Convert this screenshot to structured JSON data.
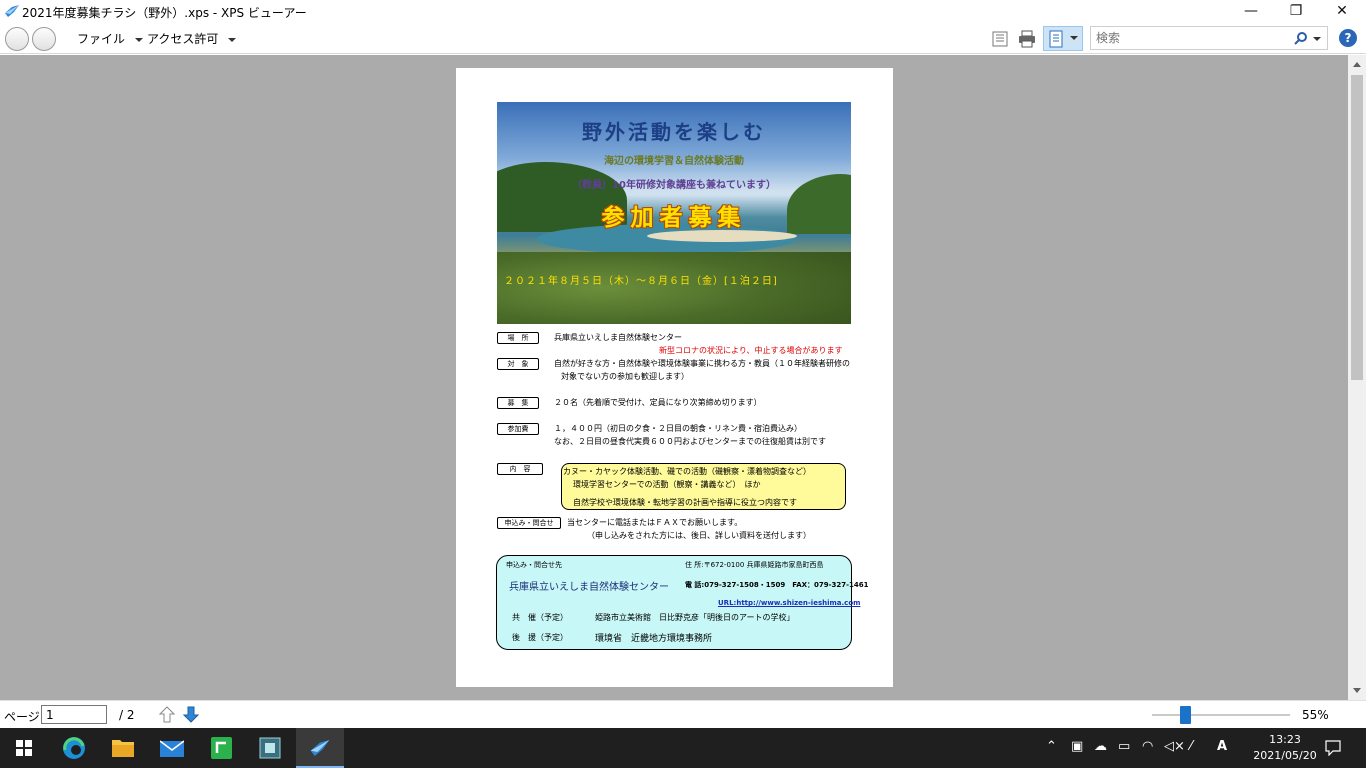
{
  "window": {
    "title": "2021年度募集チラシ（野外）.xps - XPS ビューアー",
    "minimize": "—",
    "maximize": "❐",
    "close": "✕"
  },
  "menu": {
    "file": "ファイル",
    "access": "アクセス許可"
  },
  "search": {
    "placeholder": "検索"
  },
  "help": "?",
  "flyer": {
    "title": "野外活動を楽しむ",
    "subtitle": "海辺の環境学習＆自然体験活動",
    "note": "（教員）10年研修対象講座も兼ねています）",
    "headline": "参加者募集",
    "date": "２０２１年８月５日（木）～８月６日（金）[１泊２日]",
    "rows": {
      "place_label": "場　所",
      "place_text": "兵庫県立いえしま自然体験センター",
      "corona_notice": "新型コロナの状況により、中止する場合があります",
      "target_label": "対　象",
      "target_text1": "自然が好きな方・自然体験や環境体験事業に携わる方・教員（１０年経験者研修の",
      "target_text2": "対象でない方の参加も歓迎します）",
      "recruit_label": "募　集",
      "recruit_text": "２０名（先着順で受付け、定員になり次第締め切ります）",
      "fee_label": "参加費",
      "fee_text1": "１，４００円（初日の夕食・２日目の朝食・リネン費・宿泊費込み）",
      "fee_text2": "なお、２日目の昼食代実費６００円およびセンターまでの往復船賃は別です",
      "content_label": "内　容",
      "content_line1": "カヌー・カヤック体験活動、磯での活動（磯観察・漂着物調査など）",
      "content_line2": "環境学習センターでの活動（観察・講義など）　ほか",
      "content_line3": "自然学校や環境体験・転地学習の計画や指導に役立つ内容です",
      "apply_label": "申込み・問合せ",
      "apply_text1": "当センターに電話またはＦＡＸでお願いします。",
      "apply_text2": "（申し込みをされた方には、後日、詳しい資料を送付します）"
    },
    "contact": {
      "header": "申込み・問合せ先",
      "address": "住 所:〒672-0100 兵庫県姫路市家島町西島",
      "org": "兵庫県立いえしま自然体験センター",
      "phone": "電 話:079-327-1508・1509　FAX：079-327-1461",
      "url": "URL:http://www.shizen-ieshima.com",
      "cohost_label": "共　催（予定）",
      "cohost_text": "姫路市立美術館　日比野克彦「明後日のアートの学校」",
      "support_label": "後　援（予定）",
      "support_text": "環境省　近畿地方環境事務所"
    }
  },
  "pagebar": {
    "page_label": "ページ",
    "page_value": "1",
    "page_total": "/ 2",
    "zoom": "55%",
    "zoom_fraction": 0.24
  },
  "taskbar": {
    "time": "13:23",
    "date": "2021/05/20",
    "ime": "A"
  },
  "colors": {
    "accent": "#1a73c9",
    "viewer_bg": "#ababab",
    "taskbar_bg": "#1f1f1f"
  }
}
